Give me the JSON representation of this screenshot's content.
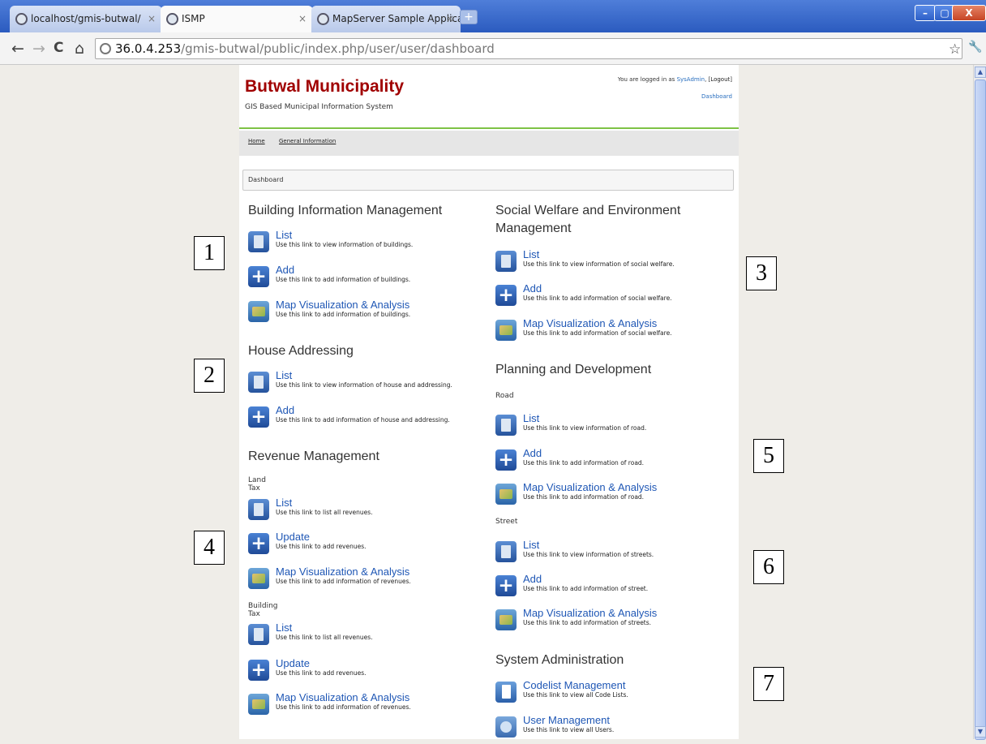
{
  "browser": {
    "tabs": [
      {
        "label": "localhost/gmis-butwal/",
        "close": "×"
      },
      {
        "label": "ISMP",
        "close": "×"
      },
      {
        "label": "MapServer Sample Application",
        "close": "×"
      }
    ],
    "new_tab": "+",
    "window": {
      "minimize": "–",
      "maximize": "▢",
      "close": "X"
    },
    "nav": {
      "back": "←",
      "forward": "→",
      "reload": "C",
      "home": "⌂"
    },
    "url_host": "36.0.4.253",
    "url_path": "/gmis-butwal/public/index.php/user/user/dashboard",
    "star": "☆",
    "wrench": "🔧",
    "scroll_up": "▲",
    "scroll_down": "▼"
  },
  "header": {
    "title": "Butwal Municipality",
    "subtitle": "GIS Based Municipal Information System",
    "login_prefix": "You are logged in as ",
    "user": "SysAdmin",
    "logout_open": ", [",
    "logout": "Logout",
    "logout_close": "]",
    "dashboard": "Dashboard"
  },
  "menu": {
    "home": "Home",
    "general": "General Information"
  },
  "breadcrumb": "Dashboard",
  "sections": {
    "building": {
      "title": "Building Information Management",
      "list": {
        "label": "List",
        "desc": "Use this link to view information of buildings."
      },
      "add": {
        "label": "Add",
        "desc": "Use this link to add information of buildings."
      },
      "map": {
        "label": "Map Visualization & Analysis",
        "desc": "Use this link to add information of buildings."
      }
    },
    "house": {
      "title": "House Addressing",
      "list": {
        "label": "List",
        "desc": "Use this link to view information of house and addressing."
      },
      "add": {
        "label": "Add",
        "desc": "Use this link to add information of house and addressing."
      }
    },
    "revenue": {
      "title": "Revenue Management",
      "land_tax": "Land Tax",
      "land_list": {
        "label": "List",
        "desc": "Use this link to list all revenues."
      },
      "land_update": {
        "label": "Update",
        "desc": "Use this link to add revenues."
      },
      "land_map": {
        "label": "Map Visualization & Analysis",
        "desc": "Use this link to add information of revenues."
      },
      "building_tax": "Building Tax",
      "building_list": {
        "label": "List",
        "desc": "Use this link to list all revenues."
      },
      "building_update": {
        "label": "Update",
        "desc": "Use this link to add revenues."
      },
      "building_map": {
        "label": "Map Visualization & Analysis",
        "desc": "Use this link to add information of revenues."
      }
    },
    "social": {
      "title_line1": "Social Welfare and Environment",
      "title_line2": "Management",
      "list": {
        "label": "List",
        "desc": "Use this link to view information of social welfare."
      },
      "add": {
        "label": "Add",
        "desc": "Use this link to add information of social welfare."
      },
      "map": {
        "label": "Map Visualization & Analysis",
        "desc": "Use this link to add information of social welfare."
      }
    },
    "planning": {
      "title": "Planning and Development",
      "road": "Road",
      "road_list": {
        "label": "List",
        "desc": "Use this link to view information of road."
      },
      "road_add": {
        "label": "Add",
        "desc": "Use this link to add information of road."
      },
      "road_map": {
        "label": "Map Visualization & Analysis",
        "desc": "Use this link to add information of road."
      },
      "street": "Street",
      "street_list": {
        "label": "List",
        "desc": "Use this link to view information of streets."
      },
      "street_add": {
        "label": "Add",
        "desc": "Use this link to add information of street."
      },
      "street_map": {
        "label": "Map Visualization & Analysis",
        "desc": "Use this link to add information of streets."
      }
    },
    "system": {
      "title": "System Administration",
      "codelist": {
        "label": "Codelist Management",
        "desc": "Use this link to view all Code Lists."
      },
      "users": {
        "label": "User Management",
        "desc": "Use this link to view all Users."
      }
    }
  },
  "annotations": [
    "1",
    "2",
    "3",
    "4",
    "5",
    "6",
    "7"
  ]
}
